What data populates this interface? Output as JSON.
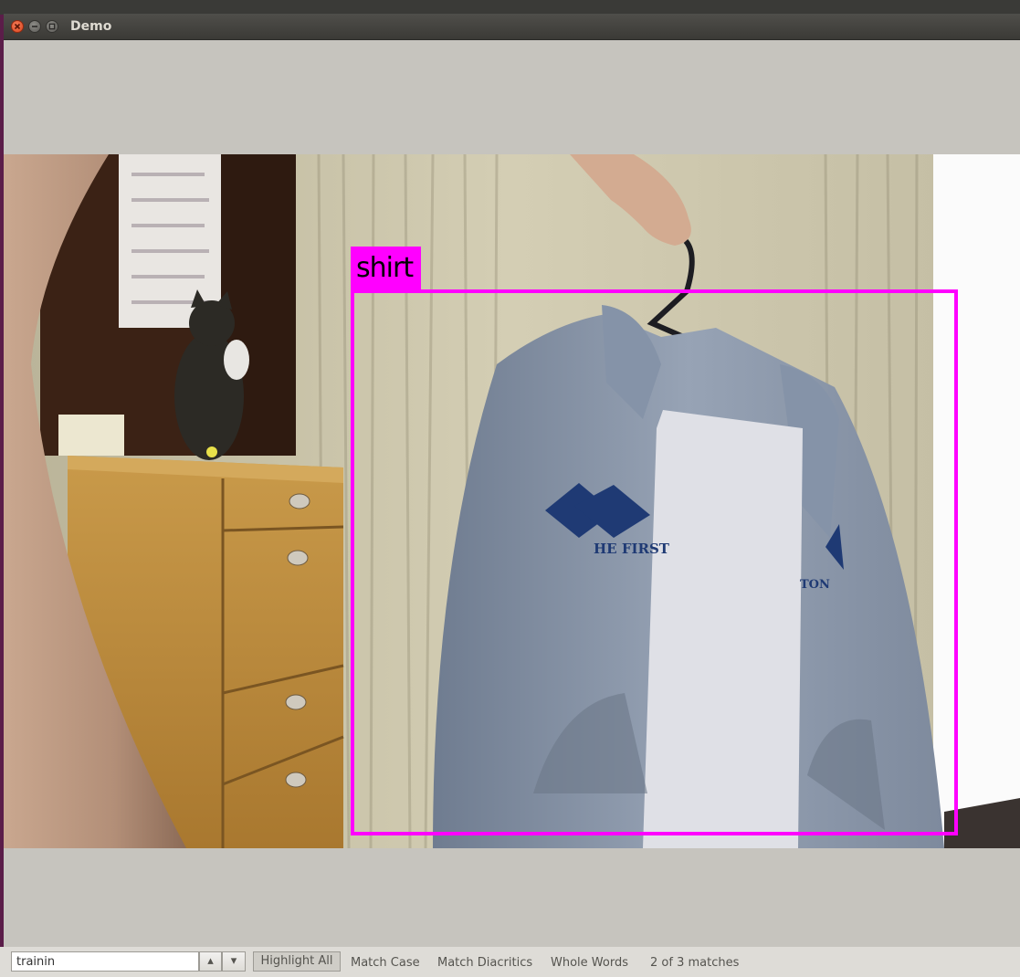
{
  "window": {
    "title": "Demo",
    "controls": [
      "close-icon",
      "minimize-icon",
      "maximize-icon"
    ]
  },
  "detection": {
    "label": "shirt",
    "color": "#ff00ff"
  },
  "scene": {
    "hoodie_print_left": "HE FIRST",
    "hoodie_print_right": "TON"
  },
  "findbar": {
    "search_value": "trainin",
    "prev_icon": "arrow-up-icon",
    "next_icon": "arrow-down-icon",
    "highlight_all": "Highlight All",
    "match_case": "Match Case",
    "match_diacritics": "Match Diacritics",
    "whole_words": "Whole Words",
    "match_count": "2 of 3 matches"
  },
  "colors": {
    "accent": "#ff00ff",
    "window_bg": "#c6c4be",
    "desktop": "#5b1d49"
  }
}
